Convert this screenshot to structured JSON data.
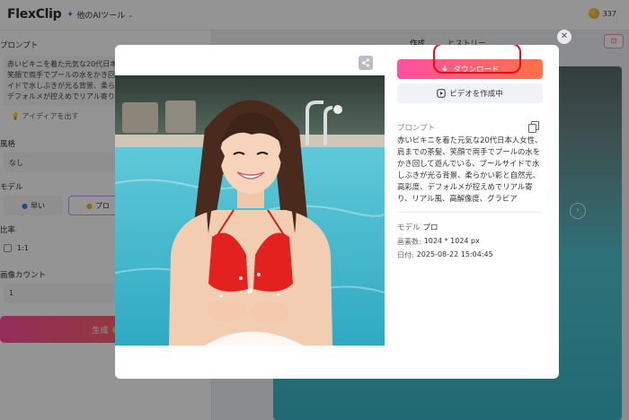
{
  "header": {
    "logo": "FlexClip",
    "ai_tools": "他のAIツール",
    "credits": "337"
  },
  "left_panel": {
    "prompt_label": "プロンプト",
    "prompt_text": "赤いビキニを着た元気な20代日本人女性、肩までの茶髪、笑顔で両手でプールの水をかき回して遊んでいる、プールサイドで水しぶきが光る背景、柔らかい影と自然光、高彩度、デフォルメが控えめでリアル寄り",
    "idea_label": "アイディアを出す",
    "style_label": "風格",
    "style_value": "なし",
    "model_label": "モデル",
    "model_fast": "早い",
    "model_pro": "プロ",
    "ratio_label": "比率",
    "ratio_value": "1:1",
    "count_label": "画像カウント",
    "count_value": "1",
    "generate_label": "生成"
  },
  "right_panel": {
    "tab_create": "作成",
    "tab_history": "ヒストリー"
  },
  "modal": {
    "download_label": "ダウンロード",
    "video_label": "ビデオを作成中",
    "prompt_heading": "プロンプト",
    "prompt_text": "赤いビキニを着た元気な20代日本人女性、肩までの茶髪、笑顔で両手でプールの水をかき回して遊んでいる、プールサイドで水しぶきが光る背景、柔らかい影と自然光、高彩度、デフォルメが控えめでリアル寄り、リアル風、高解像度、グラビア",
    "model_label": "モデル",
    "model_value": "プロ",
    "pixels_label": "画素数:",
    "pixels_value": "1024 * 1024 px",
    "date_label": "日付:",
    "date_value": "2025-08-22 15:04:45"
  }
}
